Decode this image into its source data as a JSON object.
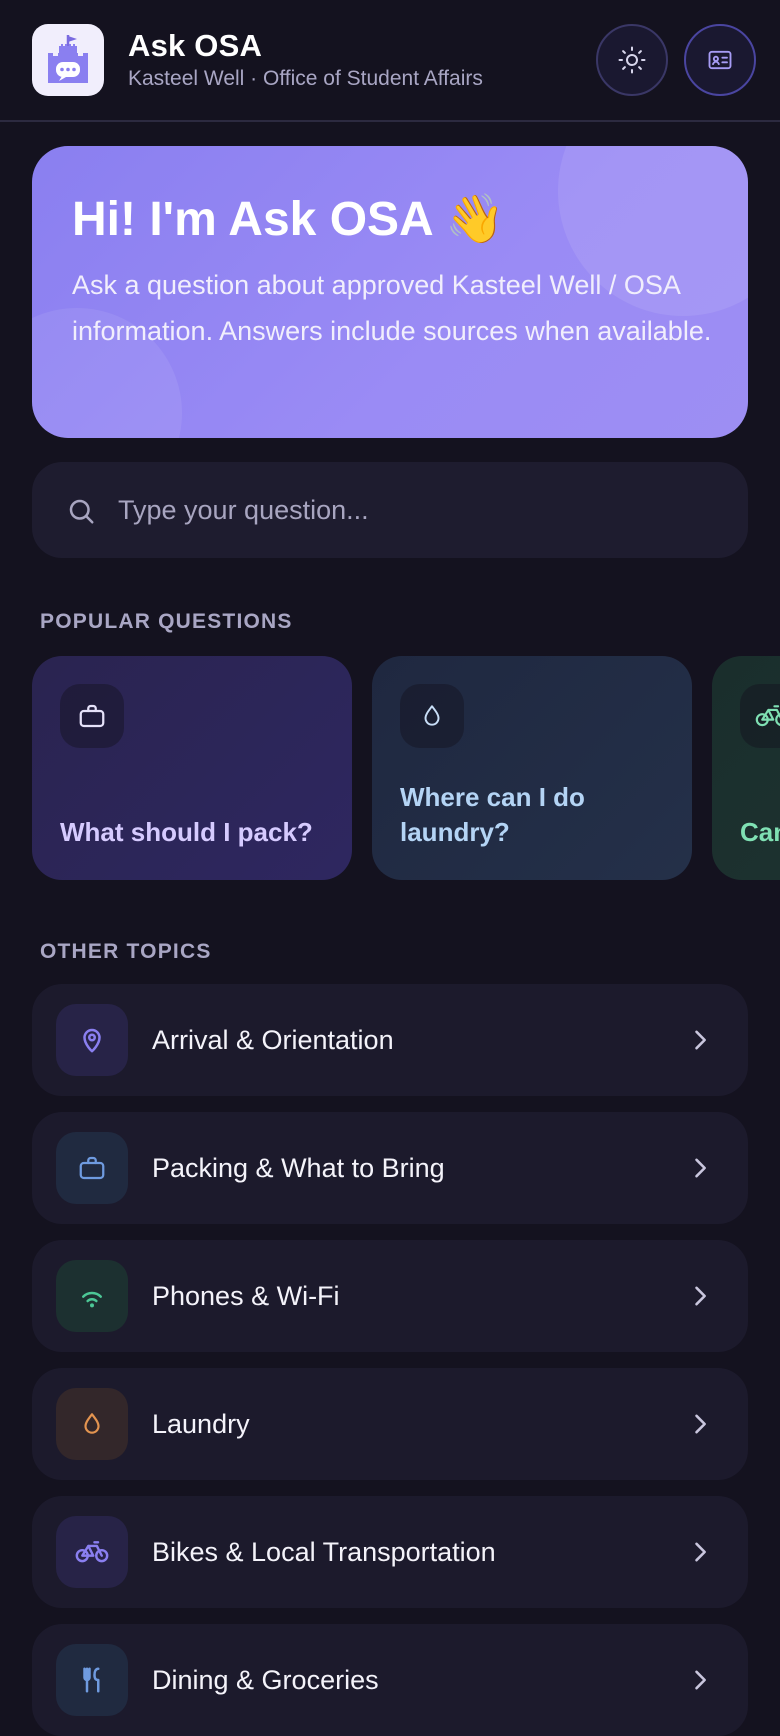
{
  "header": {
    "title": "Ask OSA",
    "subtitle": "Kasteel Well · Office of Student Affairs",
    "app_icon": "castle-chat-icon",
    "theme_button_icon": "sun-icon",
    "id_button_icon": "id-card-icon"
  },
  "hero": {
    "title": "Hi! I'm Ask OSA 👋",
    "text": "Ask a question about approved Kasteel Well / OSA information. Answers include sources when available."
  },
  "search": {
    "placeholder": "Type your question..."
  },
  "popular": {
    "label": "POPULAR QUESTIONS",
    "items": [
      {
        "text": "What should I pack?",
        "icon": "briefcase-icon",
        "color": "#d6cbff"
      },
      {
        "text": "Where can I do laundry?",
        "icon": "droplet-icon",
        "color": "#b4d4f5"
      },
      {
        "text": "Can",
        "icon": "bike-icon",
        "color": "#7fe0b3"
      }
    ]
  },
  "topics": {
    "label": "OTHER TOPICS",
    "items": [
      {
        "label": "Arrival & Orientation",
        "icon": "map-pin-icon",
        "color": "#8a7ff0"
      },
      {
        "label": "Packing & What to Bring",
        "icon": "briefcase-icon",
        "color": "#6f9be0"
      },
      {
        "label": "Phones & Wi-Fi",
        "icon": "wifi-icon",
        "color": "#4cc796"
      },
      {
        "label": "Laundry",
        "icon": "droplet-icon",
        "color": "#e39450"
      },
      {
        "label": "Bikes & Local Transportation",
        "icon": "bike-icon",
        "color": "#8a7ff0"
      },
      {
        "label": "Dining & Groceries",
        "icon": "utensils-icon",
        "color": "#6f9be0"
      }
    ]
  }
}
